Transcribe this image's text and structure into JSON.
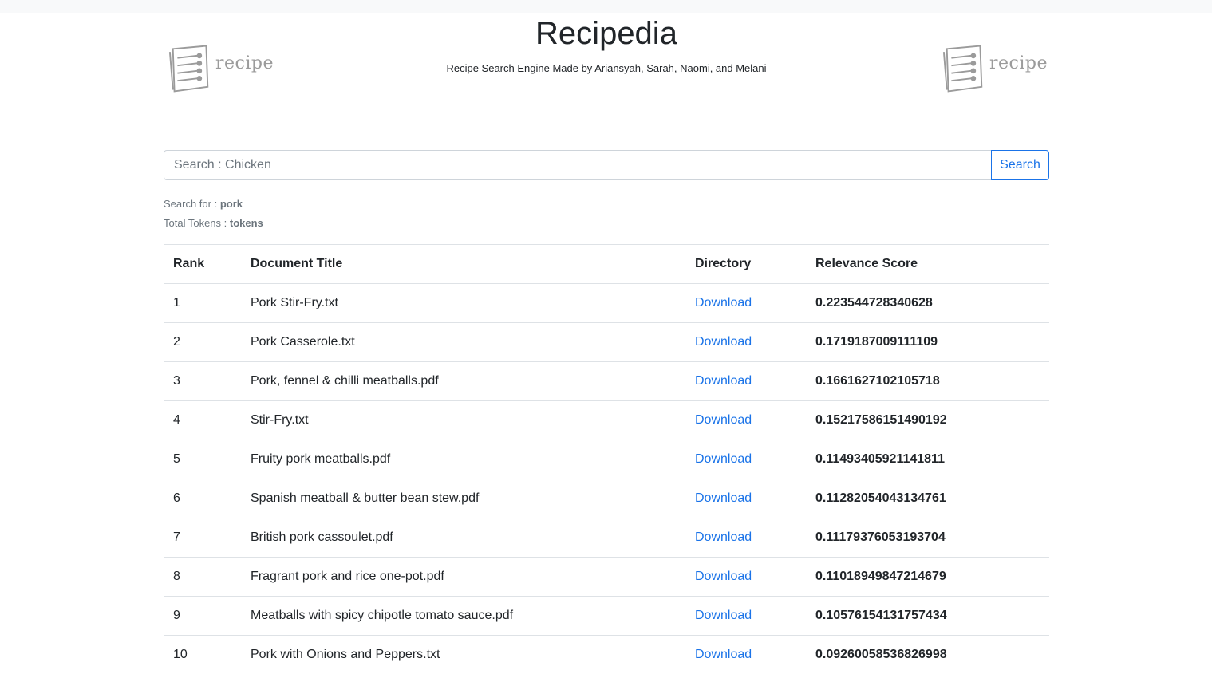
{
  "header": {
    "title": "Recipedia",
    "subtitle": "Recipe Search Engine Made by Ariansyah, Sarah, Naomi, and Melani",
    "logo_text": "recipe"
  },
  "search": {
    "placeholder": "Search : Chicken",
    "value": "",
    "button_label": "Search"
  },
  "query_info": {
    "search_for_label": "Search for : ",
    "search_for_value": "pork",
    "tokens_label": "Total Tokens : ",
    "tokens_value": "tokens"
  },
  "table": {
    "headers": {
      "rank": "Rank",
      "title": "Document Title",
      "directory": "Directory",
      "score": "Relevance Score"
    },
    "rows": [
      {
        "rank": "1",
        "title": "Pork Stir-Fry.txt",
        "link": "Download",
        "score": "0.223544728340628"
      },
      {
        "rank": "2",
        "title": "Pork Casserole.txt",
        "link": "Download",
        "score": "0.1719187009111109"
      },
      {
        "rank": "3",
        "title": "Pork, fennel & chilli meatballs.pdf",
        "link": "Download",
        "score": "0.1661627102105718"
      },
      {
        "rank": "4",
        "title": "Stir-Fry.txt",
        "link": "Download",
        "score": "0.15217586151490192"
      },
      {
        "rank": "5",
        "title": "Fruity pork meatballs.pdf",
        "link": "Download",
        "score": "0.11493405921141811"
      },
      {
        "rank": "6",
        "title": "Spanish meatball & butter bean stew.pdf",
        "link": "Download",
        "score": "0.11282054043134761"
      },
      {
        "rank": "7",
        "title": "British pork cassoulet.pdf",
        "link": "Download",
        "score": "0.11179376053193704"
      },
      {
        "rank": "8",
        "title": "Fragrant pork and rice one-pot.pdf",
        "link": "Download",
        "score": "0.11018949847214679"
      },
      {
        "rank": "9",
        "title": "Meatballs with spicy chipotle tomato sauce.pdf",
        "link": "Download",
        "score": "0.10576154131757434"
      },
      {
        "rank": "10",
        "title": "Pork with Onions and Peppers.txt",
        "link": "Download",
        "score": "0.09260058536826998"
      }
    ]
  },
  "colors": {
    "accent": "#1a73e8",
    "text": "#212529",
    "muted": "#6c757d",
    "border": "#dee2e6"
  },
  "icons": {
    "logo": "recipe-paper-icon"
  }
}
